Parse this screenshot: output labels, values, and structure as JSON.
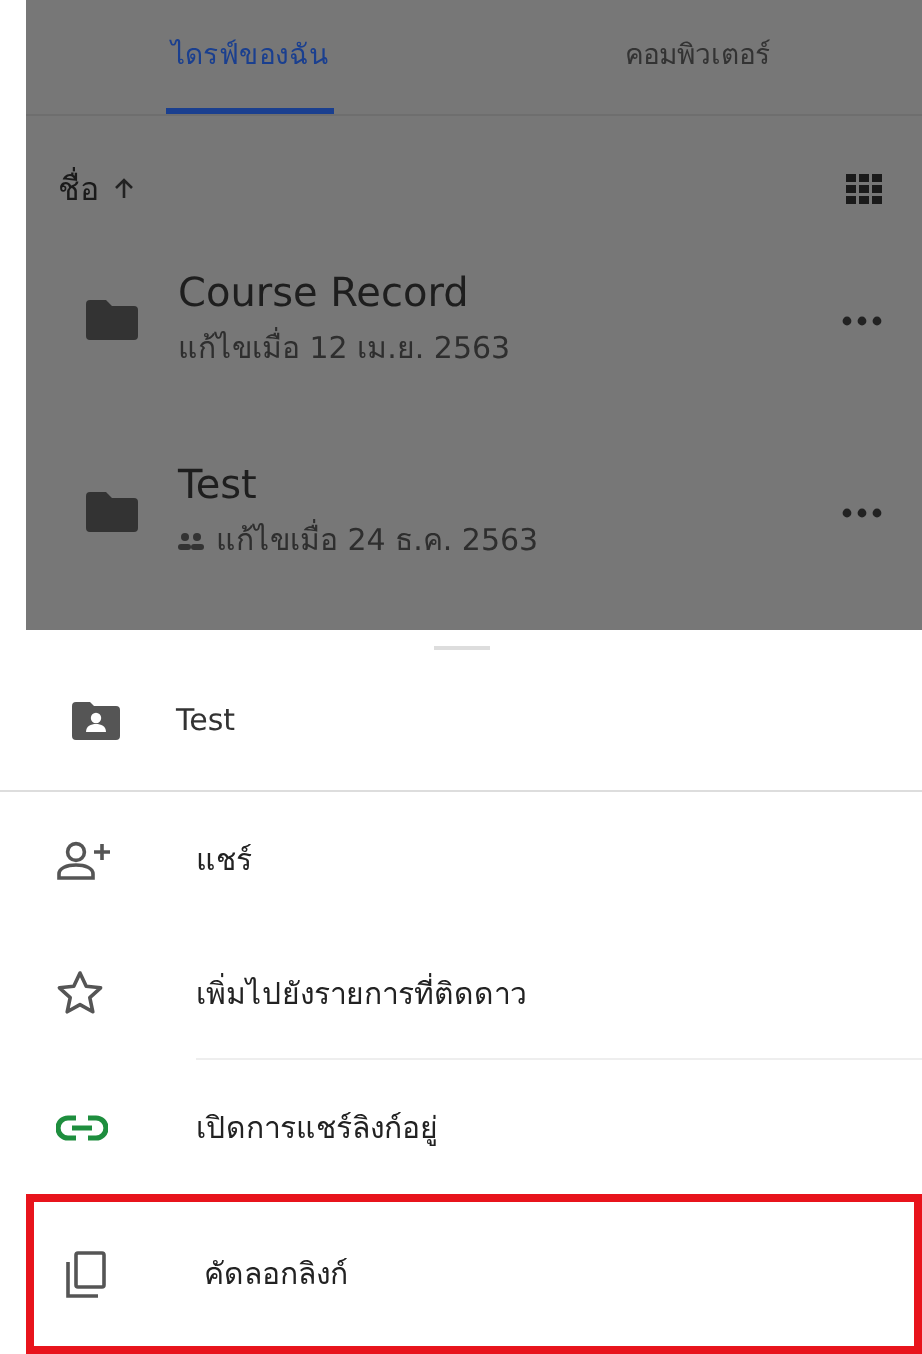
{
  "tabs": [
    {
      "label": "ไดรฟ์ของฉัน",
      "selected": true
    },
    {
      "label": "คอมพิวเตอร์",
      "selected": false
    }
  ],
  "sort": {
    "label": "ชื่อ"
  },
  "files": [
    {
      "name": "Course Record",
      "modified": "แก้ไขเมื่อ 12 เม.ย. 2563",
      "shared": false
    },
    {
      "name": "Test",
      "modified": "แก้ไขเมื่อ 24 ธ.ค. 2563",
      "shared": true
    }
  ],
  "sheet": {
    "title": "Test",
    "items": [
      {
        "kind": "share",
        "label": "แชร์",
        "divider_after": false,
        "highlighted": false
      },
      {
        "kind": "star",
        "label": "เพิ่มไปยังรายการที่ติดดาว",
        "divider_after": true,
        "highlighted": false
      },
      {
        "kind": "link",
        "label": "เปิดการแชร์ลิงก์อยู่",
        "divider_after": false,
        "highlighted": false
      },
      {
        "kind": "copy",
        "label": "คัดลอกลิงก์",
        "divider_after": false,
        "highlighted": true
      }
    ]
  }
}
